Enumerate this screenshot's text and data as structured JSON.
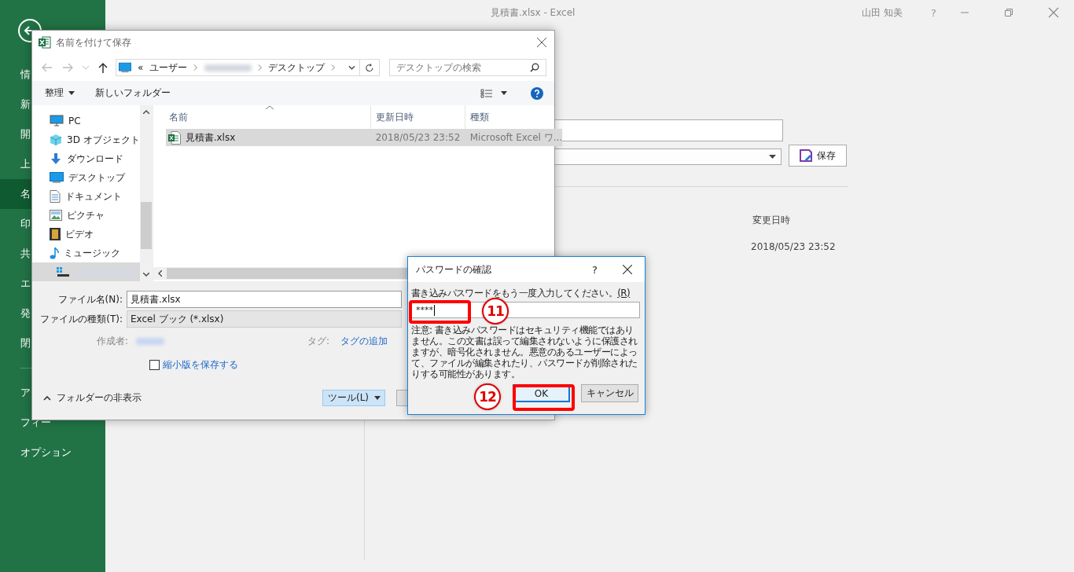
{
  "title_bar": {
    "document_title": "見積書.xlsx - Excel",
    "user": "山田 知美",
    "help": "?"
  },
  "sidebar": {
    "items": [
      {
        "label": "情",
        "selected": false
      },
      {
        "label": "新",
        "selected": false
      },
      {
        "label": "開",
        "selected": false
      },
      {
        "label": "上",
        "selected": false
      },
      {
        "label": "名",
        "selected": true
      },
      {
        "label": "印",
        "selected": false
      },
      {
        "label": "共",
        "selected": false
      },
      {
        "label": "エ",
        "selected": false
      },
      {
        "label": "発",
        "selected": false
      },
      {
        "label": "閉",
        "selected": false
      }
    ],
    "bottom_items": [
      {
        "label": "ア"
      },
      {
        "label": "フィー"
      },
      {
        "label": "オプション"
      }
    ]
  },
  "save_panel": {
    "save_button": "保存",
    "list_header": "変更日時",
    "rows": [
      {
        "modified": "2018/05/23 23:52"
      }
    ]
  },
  "save_dialog": {
    "title": "名前を付けて保存",
    "path_prefix": "«",
    "path": [
      "ユーザー",
      "デスクトップ"
    ],
    "search_placeholder": "デスクトップの検索",
    "organize": "整理",
    "new_folder": "新しいフォルダー",
    "tree": [
      {
        "label": "PC",
        "kind": "pc",
        "selected": false
      },
      {
        "label": "3D オブジェクト",
        "kind": "cube",
        "selected": false
      },
      {
        "label": "ダウンロード",
        "kind": "download",
        "selected": false
      },
      {
        "label": "デスクトップ",
        "kind": "desktop",
        "selected": false
      },
      {
        "label": "ドキュメント",
        "kind": "document",
        "selected": false
      },
      {
        "label": "ピクチャ",
        "kind": "picture",
        "selected": false
      },
      {
        "label": "ビデオ",
        "kind": "video",
        "selected": false
      },
      {
        "label": "ミュージック",
        "kind": "music",
        "selected": false
      },
      {
        "kind": "drive",
        "selected": true
      }
    ],
    "columns": [
      "名前",
      "更新日時",
      "種類"
    ],
    "files": [
      {
        "name": "見積書.xlsx",
        "modified": "2018/05/23 23:52",
        "type": "Microsoft Excel ワ...",
        "selected": true
      }
    ],
    "file_name_label": "ファイル名(N):",
    "file_name": "見積書.xlsx",
    "file_type_label": "ファイルの種類(T):",
    "file_type": "Excel ブック (*.xlsx)",
    "author_label": "作成者:",
    "tags_label": "タグ:",
    "tags_link": "タグの追加",
    "thumbnail": {
      "label": "縮小版を保存する",
      "checked": false
    },
    "hide_folders": "フォルダーの非表示",
    "tools": "ツール(L)"
  },
  "password_dialog": {
    "title": "パスワードの確認",
    "help": "?",
    "prompt": "書き込みパスワードをもう一度入力してください。",
    "access_key": "(R)",
    "password": "****",
    "note": "注意: 書き込みパスワードはセキュリティ機能ではありません。この文書は誤って編集されないように保護されますが、暗号化されません。悪意のあるユーザーによって、ファイルが編集されたり、パスワードが削除されたりする可能性があります。",
    "ok": "OK",
    "cancel": "キャンセル"
  },
  "annotations": [
    {
      "number": "11"
    },
    {
      "number": "12"
    }
  ]
}
